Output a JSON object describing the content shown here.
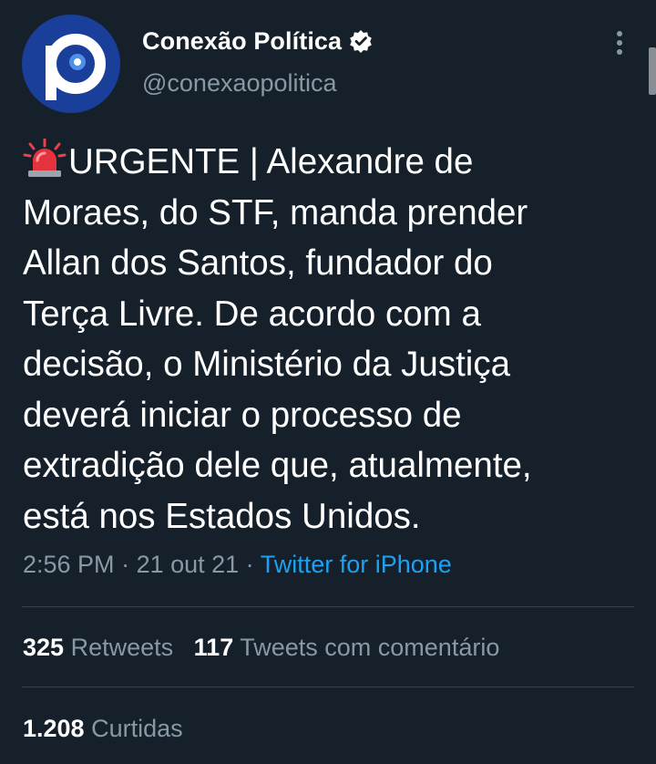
{
  "author": {
    "name": "Conexão Política",
    "handle": "@conexaopolitica",
    "verified": true,
    "avatar_icon": "conexao-politica-logo",
    "avatar_colors": {
      "background": "#1a3f9a",
      "ring": "#ffffff"
    }
  },
  "tweet": {
    "emoji": "police-siren-icon",
    "text": "URGENTE | Alexandre de\nMoraes, do STF, manda prender\nAllan dos Santos, fundador do\nTerça Livre. De acordo com a\ndecisão, o Ministério da Justiça\ndeverá iniciar o processo de\nextradição dele que, atualmente,\nestá nos Estados Unidos."
  },
  "meta": {
    "time": "2:56 PM",
    "sep1": " · ",
    "date": "21 out 21",
    "sep2": " · ",
    "source": "Twitter for iPhone"
  },
  "stats": {
    "retweets_count": "325",
    "retweets_label": "Retweets",
    "quote_count": "117",
    "quote_label": "Tweets com comentário",
    "likes_count": "1.208",
    "likes_label": "Curtidas"
  },
  "colors": {
    "background": "#15202b",
    "secondary_text": "#8899a6",
    "link": "#1da1f2",
    "divider": "#38444d"
  }
}
